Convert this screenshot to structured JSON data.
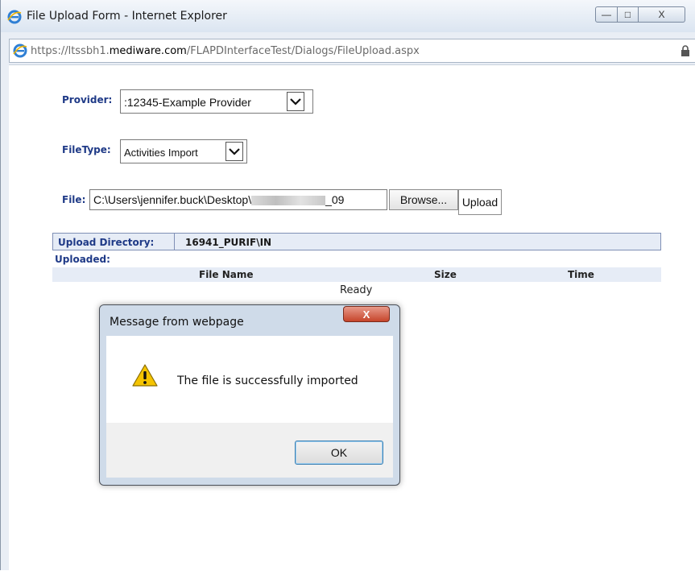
{
  "window": {
    "title": "File Upload Form - Internet Explorer",
    "minimize": "—",
    "maximize": "□",
    "close": "X"
  },
  "address": {
    "scheme": "https://ltssbh1.",
    "host": "mediware.com",
    "path": "/FLAPDInterfaceTest/Dialogs/FileUpload.aspx"
  },
  "form": {
    "provider_label": "Provider:",
    "provider_value": ":12345-Example Provider",
    "filetype_label": "FileType:",
    "filetype_value": "Activities Import",
    "file_label": "File:",
    "file_path_prefix": "C:\\Users\\jennifer.buck\\Desktop\\",
    "file_path_suffix": "_09",
    "browse_label": "Browse...",
    "upload_label": "Upload"
  },
  "directory": {
    "label": "Upload Directory:",
    "value": "16941_PURIF\\IN"
  },
  "uploaded": {
    "label": "Uploaded:",
    "columns": [
      "File Name",
      "Size",
      "Time"
    ],
    "status": "Ready"
  },
  "dialog": {
    "title": "Message from webpage",
    "close": "X",
    "message": "The file is successfully imported",
    "ok_label": "OK"
  },
  "colors": {
    "label_blue": "#1f3a87",
    "header_bg": "#e6ecf6"
  }
}
